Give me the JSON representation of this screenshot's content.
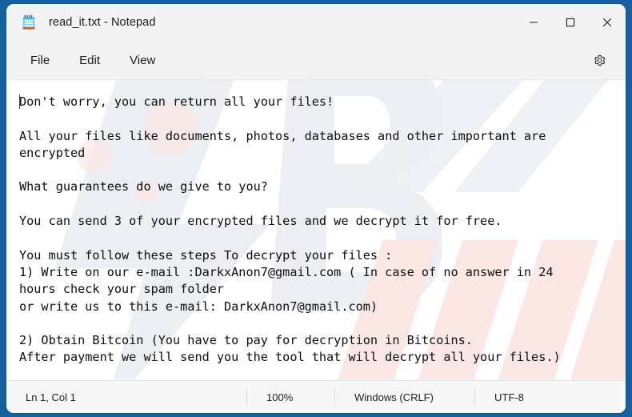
{
  "window": {
    "title": "read_it.txt - Notepad",
    "app_icon": "notepad-icon",
    "accent_color": "#16609f",
    "background_color": "#ffffff",
    "controls": {
      "minimize": "—",
      "maximize": "☐",
      "close": "✕"
    }
  },
  "menubar": {
    "items": [
      {
        "label": "File"
      },
      {
        "label": "Edit"
      },
      {
        "label": "View"
      }
    ],
    "settings_icon": "gear-icon"
  },
  "editor": {
    "content": "Don't worry, you can return all your files!\n\nAll your files like documents, photos, databases and other important are\nencrypted\n\nWhat guarantees do we give to you?\n\nYou can send 3 of your encrypted files and we decrypt it for free.\n\nYou must follow these steps To decrypt your files :\n1) Write on our e-mail :DarkxAnon7@gmail.com ( In case of no answer in 24\nhours check your spam folder\nor write us to this e-mail: DarkxAnon7@gmail.com)\n\n2) Obtain Bitcoin (You have to pay for decryption in Bitcoins.\nAfter payment we will send you the tool that will decrypt all your files.)",
    "contact_email": "DarkxAnon7@gmail.com",
    "caret_position": "before-first-character"
  },
  "statusbar": {
    "position": "Ln 1, Col 1",
    "zoom": "100%",
    "line_ending": "Windows (CRLF)",
    "encoding": "UTF-8"
  }
}
